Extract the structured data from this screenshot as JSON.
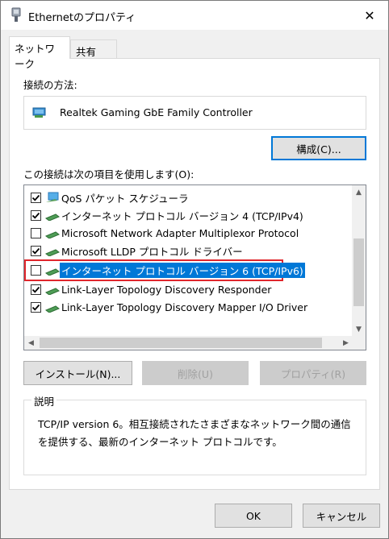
{
  "window": {
    "title": "Ethernetのプロパティ",
    "close_glyph": "✕"
  },
  "tabs": [
    {
      "label": "ネットワーク",
      "active": true
    },
    {
      "label": "共有",
      "active": false
    }
  ],
  "connection": {
    "label": "接続の方法:",
    "adapter_name": "Realtek Gaming GbE Family Controller",
    "configure_button": "構成(C)..."
  },
  "items_section": {
    "label": "この接続は次の項目を使用します(O):",
    "items": [
      {
        "label": "QoS パケット スケジューラ",
        "checked": true,
        "icon": "qos-icon"
      },
      {
        "label": "インターネット プロトコル バージョン 4 (TCP/IPv4)",
        "checked": true,
        "icon": "protocol-icon"
      },
      {
        "label": "Microsoft Network Adapter Multiplexor Protocol",
        "checked": false,
        "icon": "protocol-icon"
      },
      {
        "label": "Microsoft LLDP プロトコル ドライバー",
        "checked": true,
        "icon": "protocol-icon"
      },
      {
        "label": "インターネット プロトコル バージョン 6 (TCP/IPv6)",
        "checked": false,
        "icon": "protocol-icon",
        "selected": true
      },
      {
        "label": "Link-Layer Topology Discovery Responder",
        "checked": true,
        "icon": "protocol-icon"
      },
      {
        "label": "Link-Layer Topology Discovery Mapper I/O Driver",
        "checked": true,
        "icon": "protocol-icon"
      }
    ]
  },
  "buttons": {
    "install": "インストール(N)...",
    "uninstall": "削除(U)",
    "properties": "プロパティ(R)"
  },
  "description": {
    "legend": "説明",
    "text": "TCP/IP version 6。相互接続されたさまざまなネットワーク間の通信を提供する、最新のインターネット プロトコルです。"
  },
  "footer": {
    "ok": "OK",
    "cancel": "キャンセル"
  },
  "colors": {
    "selection": "#0078d7",
    "highlight_border": "#e0262c",
    "primary_border": "#0078d7"
  }
}
